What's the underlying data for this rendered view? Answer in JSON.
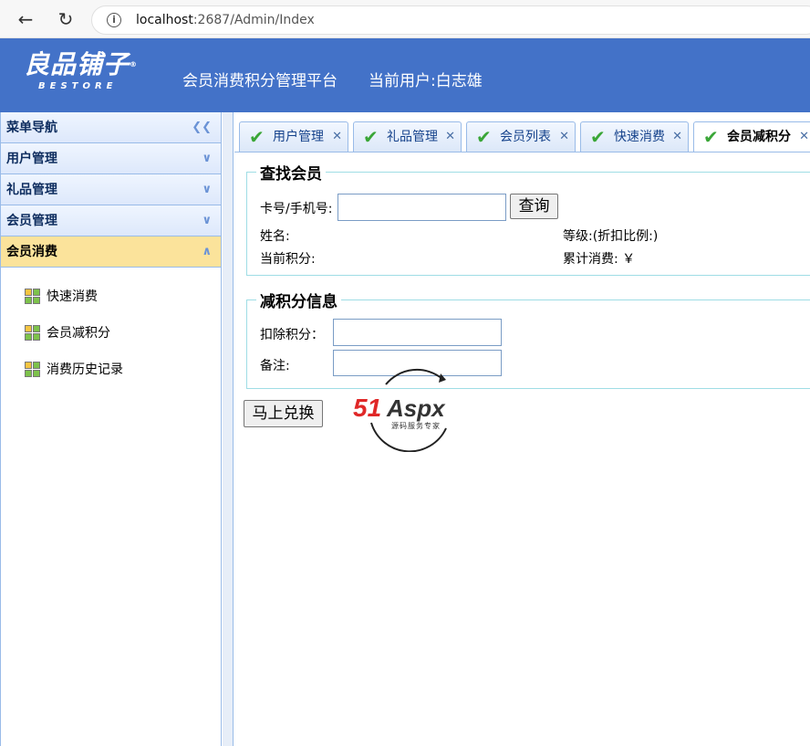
{
  "browser": {
    "url_host": "localhost",
    "url_path": ":2687/Admin/Index"
  },
  "header": {
    "logo_text": "良品铺子",
    "logo_sub": "BESTORE",
    "title": "会员消费积分管理平台",
    "current_user": "当前用户:白志雄"
  },
  "sidebar": {
    "nav_title": "菜单导航",
    "sections": [
      {
        "label": "用户管理"
      },
      {
        "label": "礼品管理"
      },
      {
        "label": "会员管理"
      },
      {
        "label": "会员消费"
      }
    ],
    "items": [
      {
        "label": "快速消费"
      },
      {
        "label": "会员减积分"
      },
      {
        "label": "消费历史记录"
      }
    ]
  },
  "tabs": [
    {
      "label": "用户管理"
    },
    {
      "label": "礼品管理"
    },
    {
      "label": "会员列表"
    },
    {
      "label": "快速消费"
    },
    {
      "label": "会员减积分"
    }
  ],
  "search_member": {
    "legend": "查找会员",
    "card_label": "卡号/手机号:",
    "card_value": "",
    "query_button": "查询",
    "name_label": "姓名:",
    "level_label": "等级:(折扣比例:)",
    "points_label": "当前积分:",
    "total_label": "累计消费: ￥"
  },
  "deduct": {
    "legend": "减积分信息",
    "points_label": "扣除积分：",
    "points_value": "",
    "remark_label": "备注:",
    "remark_value": "",
    "submit_button": "马上兑换"
  },
  "watermark": {
    "brand_a": "51",
    "brand_b": "Aspx",
    "tagline": "源码服务专家"
  }
}
